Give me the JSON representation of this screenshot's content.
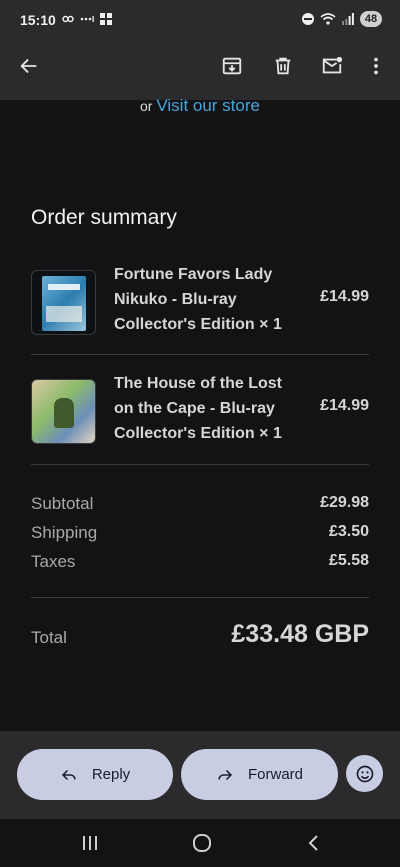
{
  "status_bar": {
    "time": "15:10",
    "battery": "48",
    "icons": [
      "link-icon",
      "dots-icon",
      "grid-icon",
      "dnd-icon",
      "wifi-icon",
      "signal-icon",
      "battery-icon"
    ]
  },
  "toolbar": {
    "back_icon": "arrow-left-icon",
    "archive_icon": "archive-icon",
    "delete_icon": "trash-icon",
    "mark_unread_icon": "mail-unread-icon",
    "more_icon": "more-vert-icon"
  },
  "store": {
    "prefix": "or",
    "link": "Visit our store"
  },
  "order_summary": {
    "title": "Order summary",
    "items": [
      {
        "name": "Fortune Favors Lady Nikuko - Blu-ray Collector's Edition × 1",
        "price": "£14.99"
      },
      {
        "name": "The House of the Lost on the Cape - Blu-ray Collector's Edition × 1",
        "price": "£14.99"
      }
    ],
    "subtotal_label": "Subtotal",
    "subtotal": "£29.98",
    "shipping_label": "Shipping",
    "shipping": "£3.50",
    "taxes_label": "Taxes",
    "taxes": "£5.58",
    "total_label": "Total",
    "total": "£33.48 GBP"
  },
  "actions": {
    "reply": "Reply",
    "forward": "Forward"
  },
  "colors": {
    "background": "#131316",
    "bar": "#2b2b2e",
    "link": "#4aa4d8",
    "pill": "#c9cde4"
  }
}
